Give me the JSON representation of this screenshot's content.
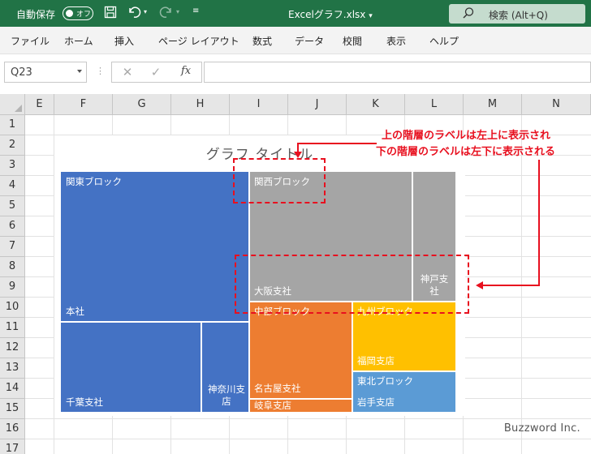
{
  "titlebar": {
    "autosave_label": "自動保存",
    "autosave_state": "オフ",
    "document_title": "Excelグラフ.xlsx",
    "search_label": "検索 (Alt+Q)",
    "accent_color": "#217346"
  },
  "menu": {
    "items": [
      "ファイル",
      "ホーム",
      "挿入",
      "ページ レイアウト",
      "数式",
      "データ",
      "校閲",
      "表示",
      "ヘルプ"
    ]
  },
  "formula_bar": {
    "name_box": "Q23",
    "cancel_icon": "✕",
    "enter_icon": "✓",
    "function_label": "fx",
    "formula": ""
  },
  "sheet": {
    "columns": [
      "E",
      "F",
      "G",
      "H",
      "I",
      "J",
      "K",
      "L",
      "M",
      "N"
    ],
    "rows": [
      "1",
      "2",
      "3",
      "4",
      "5",
      "6",
      "7",
      "8",
      "9",
      "10",
      "11",
      "12",
      "13",
      "14",
      "15",
      "16",
      "17"
    ]
  },
  "chart_data": {
    "type": "treemap",
    "title": "グラフ タイトル",
    "groups": [
      {
        "name": "関東ブロック",
        "color": "#4472c4",
        "items": [
          {
            "name": "本社",
            "level": "large"
          },
          {
            "name": "千葉支社",
            "level": "medium"
          },
          {
            "name": "神奈川支店",
            "level": "small"
          }
        ]
      },
      {
        "name": "関西ブロック",
        "color": "#a5a5a5",
        "items": [
          {
            "name": "大阪支社",
            "level": "large"
          },
          {
            "name": "神戸支社",
            "level": "small"
          }
        ]
      },
      {
        "name": "中部ブロック",
        "color": "#ed7d31",
        "items": [
          {
            "name": "名古屋支社",
            "level": "medium"
          },
          {
            "name": "岐阜支店",
            "level": "small"
          }
        ]
      },
      {
        "name": "九州ブロック",
        "color": "#ffc000",
        "items": [
          {
            "name": "福岡支店",
            "level": "medium"
          }
        ]
      },
      {
        "name": "東北ブロック",
        "color": "#5b9bd5",
        "items": [
          {
            "name": "岩手支店",
            "level": "small"
          }
        ]
      }
    ]
  },
  "labels": {
    "kanto_block": "関東ブロック",
    "honsha": "本社",
    "chiba": "千葉支社",
    "kanagawa_1": "神奈川支",
    "kanagawa_2": "店",
    "kansai_block": "関西ブロック",
    "osaka": "大阪支社",
    "kobe_1": "神戸支",
    "kobe_2": "社",
    "chubu_block": "中部ブロック",
    "nagoya": "名古屋支社",
    "gifu": "岐阜支店",
    "kyushu_block": "九州ブロック",
    "fukuoka": "福岡支店",
    "tohoku_block": "東北ブロック",
    "iwate": "岩手支店"
  },
  "annotation": {
    "line1": "上の階層のラベルは左上に表示され",
    "line2": "下の階層のラベルは左下に表示される",
    "color": "#e8101f"
  },
  "credit": "Buzzword Inc."
}
